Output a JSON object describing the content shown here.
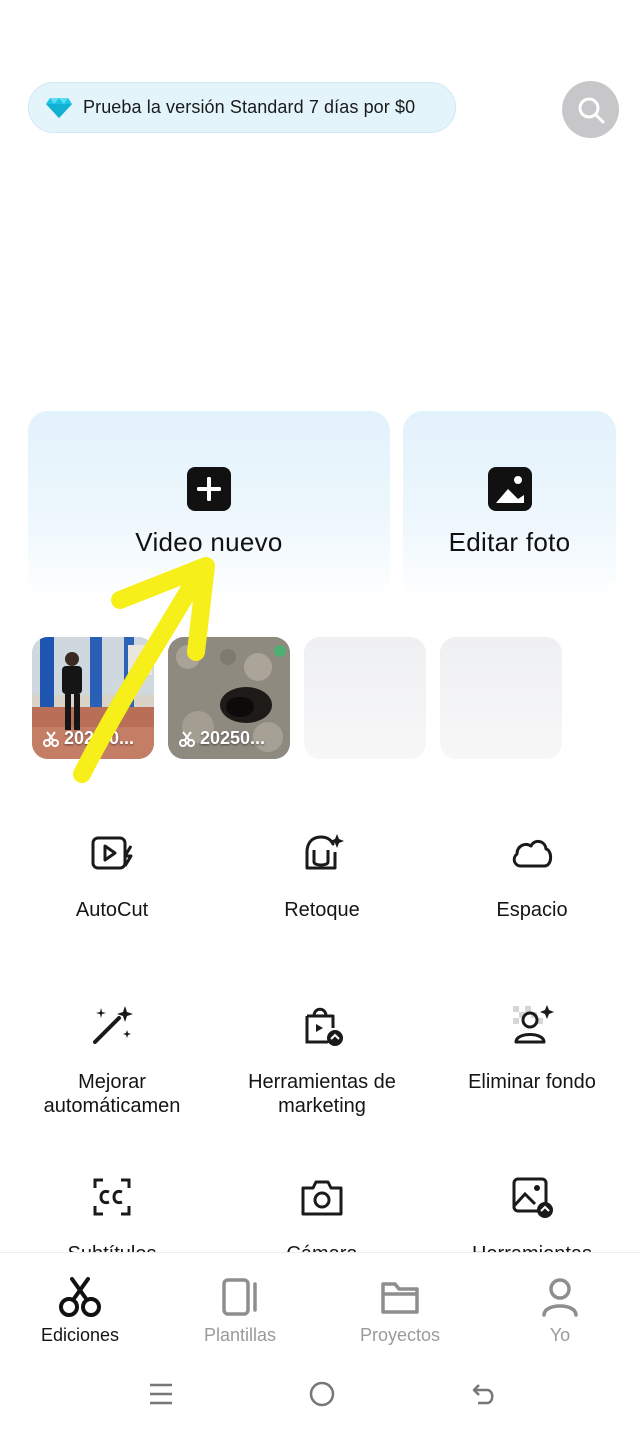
{
  "promo": {
    "text": "Prueba la versión Standard 7 días por $0",
    "icon": "diamond-icon"
  },
  "header": {
    "search_icon": "search-icon"
  },
  "cards": [
    {
      "label": "Video nuevo",
      "icon": "plus-square-icon"
    },
    {
      "label": "Editar foto",
      "icon": "photo-icon"
    }
  ],
  "recent": [
    {
      "caption": "2025 0...",
      "icon": "scissors-icon"
    },
    {
      "caption": "20250...",
      "icon": "scissors-icon"
    }
  ],
  "tools": [
    {
      "label": "AutoCut",
      "icon": "autocut-icon"
    },
    {
      "label": "Retoque",
      "icon": "retouch-icon"
    },
    {
      "label": "Espacio",
      "icon": "cloud-icon"
    },
    {
      "label": "Mejorar automáticamen",
      "icon": "magic-wand-icon"
    },
    {
      "label": "Herramientas de marketing",
      "icon": "shopping-bag-icon"
    },
    {
      "label": "Eliminar fondo",
      "icon": "remove-background-icon"
    },
    {
      "label": "Subtítulos",
      "icon": "captions-icon"
    },
    {
      "label": "Cámara",
      "icon": "camera-icon"
    },
    {
      "label": "Herramientas",
      "icon": "image-tools-icon"
    }
  ],
  "nav": [
    {
      "label": "Ediciones",
      "icon": "scissors-icon",
      "active": true
    },
    {
      "label": "Plantillas",
      "icon": "templates-icon",
      "active": false
    },
    {
      "label": "Proyectos",
      "icon": "folder-icon",
      "active": false
    },
    {
      "label": "Yo",
      "icon": "person-icon",
      "active": false
    }
  ],
  "colors": {
    "accent_gem": "#19c6e6",
    "annotation": "#f7ef1a",
    "card_bg": "#e2f2fb"
  }
}
